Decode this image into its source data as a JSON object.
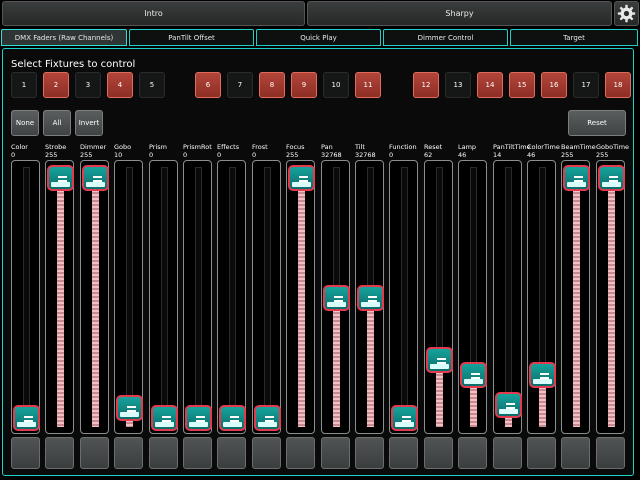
{
  "top_tabs": [
    {
      "label": "Intro"
    },
    {
      "label": "Sharpy"
    }
  ],
  "tabs": [
    {
      "label": "DMX Faders (Raw Channels)",
      "active": true
    },
    {
      "label": "PanTilt Offset",
      "active": false
    },
    {
      "label": "Quick Play",
      "active": false
    },
    {
      "label": "Dimmer Control",
      "active": false
    },
    {
      "label": "Target",
      "active": false
    }
  ],
  "heading": "Select Fixtures to control",
  "fixtures": [
    {
      "label": "1",
      "on": false
    },
    {
      "label": "2",
      "on": true
    },
    {
      "label": "3",
      "on": false
    },
    {
      "label": "4",
      "on": true
    },
    {
      "label": "5",
      "on": false
    },
    {
      "label": "6",
      "on": true
    },
    {
      "label": "7",
      "on": false
    },
    {
      "label": "8",
      "on": true
    },
    {
      "label": "9",
      "on": true
    },
    {
      "label": "10",
      "on": false
    },
    {
      "label": "11",
      "on": true
    },
    {
      "label": "12",
      "on": true
    },
    {
      "label": "13",
      "on": false
    },
    {
      "label": "14",
      "on": true
    },
    {
      "label": "15",
      "on": true
    },
    {
      "label": "16",
      "on": true
    },
    {
      "label": "17",
      "on": false
    },
    {
      "label": "18",
      "on": true
    }
  ],
  "controls": {
    "none": "None",
    "all": "All",
    "invert": "Invert",
    "reset": "Reset"
  },
  "channel_max": 65535,
  "channels": [
    {
      "name": "Color",
      "value": "0",
      "level": 0
    },
    {
      "name": "Strobe",
      "value": "255",
      "level": 1
    },
    {
      "name": "Dimmer",
      "value": "255",
      "level": 1
    },
    {
      "name": "Gobo",
      "value": "10",
      "level": 0.04
    },
    {
      "name": "Prism",
      "value": "0",
      "level": 0
    },
    {
      "name": "PrismRot",
      "value": "0",
      "level": 0
    },
    {
      "name": "Effects",
      "value": "0",
      "level": 0
    },
    {
      "name": "Frost",
      "value": "0",
      "level": 0
    },
    {
      "name": "Focus",
      "value": "255",
      "level": 1
    },
    {
      "name": "Pan",
      "value": "32768",
      "level": 0.5
    },
    {
      "name": "Tilt",
      "value": "32768",
      "level": 0.5
    },
    {
      "name": "Function",
      "value": "0",
      "level": 0
    },
    {
      "name": "Reset",
      "value": "62",
      "level": 0.243
    },
    {
      "name": "Lamp",
      "value": "46",
      "level": 0.18
    },
    {
      "name": "PanTiltTime",
      "value": "14",
      "level": 0.055
    },
    {
      "name": "ColorTime",
      "value": "46",
      "level": 0.18
    },
    {
      "name": "BeamTime",
      "value": "255",
      "level": 1
    },
    {
      "name": "GoboTime",
      "value": "255",
      "level": 1
    }
  ]
}
